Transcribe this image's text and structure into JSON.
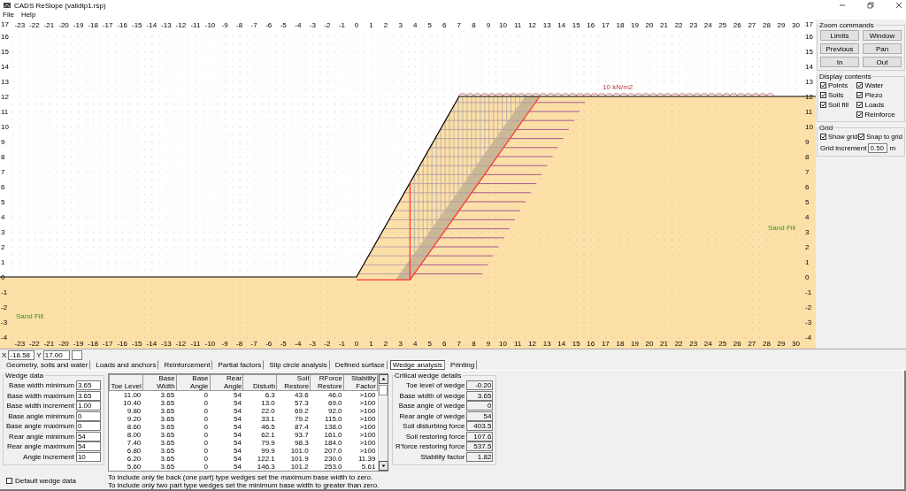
{
  "window": {
    "title": "CADS ReSlope (validtp1.rsp)"
  },
  "menu": [
    "File",
    "Help"
  ],
  "canvas": {
    "top_ruler": [
      "-23",
      "-22",
      "-21",
      "-20",
      "-19",
      "-18",
      "-17",
      "-16",
      "-15",
      "-14",
      "-13",
      "-12",
      "-11",
      "-10",
      "-9",
      "-8",
      "-7",
      "-6",
      "-5",
      "-4",
      "-3",
      "-2",
      "-1",
      "0",
      "1",
      "2",
      "3",
      "4",
      "5",
      "6",
      "7",
      "8",
      "9",
      "10",
      "11",
      "12",
      "13",
      "14",
      "15",
      "16",
      "17",
      "18",
      "19",
      "20",
      "21",
      "22",
      "23",
      "24",
      "25",
      "26",
      "27",
      "28",
      "29",
      "30"
    ],
    "bottom_ruler": [
      "-23",
      "-22",
      "-21",
      "-20",
      "-19",
      "-18",
      "-17",
      "-16",
      "-15",
      "-14",
      "-13",
      "-12",
      "-11",
      "-10",
      "-9",
      "-8",
      "-7",
      "-6",
      "-5",
      "-4",
      "-3",
      "-2",
      "-1",
      "0",
      "1",
      "2",
      "3",
      "4",
      "5",
      "6",
      "7",
      "8",
      "9",
      "10",
      "11",
      "12",
      "13",
      "14",
      "15",
      "16",
      "17",
      "18",
      "19",
      "20",
      "21",
      "22",
      "23",
      "24",
      "25",
      "26",
      "27",
      "28",
      "29",
      "30"
    ],
    "left_ruler": [
      "17",
      "16",
      "15",
      "14",
      "13",
      "12",
      "11",
      "10",
      "9",
      "8",
      "7",
      "6",
      "5",
      "4",
      "3",
      "2",
      "1",
      "0",
      "-1",
      "-2",
      "-3",
      "-4"
    ],
    "right_ruler": [
      "17",
      "16",
      "15",
      "14",
      "13",
      "12",
      "11",
      "10",
      "9",
      "8",
      "7",
      "6",
      "5",
      "4",
      "3",
      "2",
      "1",
      "0",
      "-1",
      "-2",
      "-3",
      "-4"
    ],
    "load_label": "10 kN/m2",
    "soil_labels": [
      "Sand Fill",
      "Sand Fill"
    ]
  },
  "coordinates": {
    "x_label": "X",
    "x_value": "-18.58",
    "y_label": "Y",
    "y_value": "17.00"
  },
  "tabs": [
    {
      "label": "Geometry, soils and water",
      "selected": false
    },
    {
      "label": "Loads and anchors",
      "selected": false
    },
    {
      "label": "Reinforcement",
      "selected": false
    },
    {
      "label": "Partial factors",
      "selected": false
    },
    {
      "label": "Slip circle analysis",
      "selected": false
    },
    {
      "label": "Defined surface",
      "selected": false
    },
    {
      "label": "Wedge analysis",
      "selected": true
    },
    {
      "label": "Printing",
      "selected": false
    }
  ],
  "wedge_data": {
    "title": "Wedge data",
    "fields": [
      {
        "label": "Base width minimum",
        "value": "3.65"
      },
      {
        "label": "Base width maximum",
        "value": "3.65"
      },
      {
        "label": "Base width increment",
        "value": "1.00"
      },
      {
        "label": "Base angle minimum",
        "value": "0"
      },
      {
        "label": "Base angle maximum",
        "value": "0"
      },
      {
        "label": "Rear angle minimum",
        "value": "54"
      },
      {
        "label": "Rear angle maximum",
        "value": "54"
      },
      {
        "label": "Angle increment",
        "value": "10"
      }
    ]
  },
  "table": {
    "columns": [
      "Toe Level",
      "Base Width",
      "Base Angle",
      "Rear Angle",
      "Disturb",
      "Soil Restore",
      "RForce Restore",
      "Stability Factor"
    ],
    "rows": [
      [
        "11.00",
        "3.65",
        "0",
        "54",
        "6.3",
        "43.6",
        "46.0",
        ">100"
      ],
      [
        "10.40",
        "3.65",
        "0",
        "54",
        "13.0",
        "57.3",
        "69.0",
        ">100"
      ],
      [
        "9.80",
        "3.65",
        "0",
        "54",
        "22.0",
        "69.2",
        "92.0",
        ">100"
      ],
      [
        "9.20",
        "3.65",
        "0",
        "54",
        "33.1",
        "79.2",
        "115.0",
        ">100"
      ],
      [
        "8.60",
        "3.65",
        "0",
        "54",
        "46.5",
        "87.4",
        "138.0",
        ">100"
      ],
      [
        "8.00",
        "3.65",
        "0",
        "54",
        "62.1",
        "93.7",
        "161.0",
        ">100"
      ],
      [
        "7.40",
        "3.65",
        "0",
        "54",
        "79.9",
        "98.3",
        "184.0",
        ">100"
      ],
      [
        "6.80",
        "3.65",
        "0",
        "54",
        "99.9",
        "101.0",
        "207.0",
        ">100"
      ],
      [
        "6.20",
        "3.65",
        "0",
        "54",
        "122.1",
        "101.9",
        "230.0",
        "11.39"
      ],
      [
        "5.60",
        "3.65",
        "0",
        "54",
        "146.3",
        "101.2",
        "253.0",
        "5.61"
      ]
    ]
  },
  "critical": {
    "title": "Critical wedge details",
    "fields": [
      {
        "label": "Toe level of wedge",
        "value": "-0.20"
      },
      {
        "label": "Base width of wedge",
        "value": "3.65"
      },
      {
        "label": "Base angle of wedge",
        "value": "0"
      },
      {
        "label": "Rear angle of wedge",
        "value": "54"
      },
      {
        "label": "Soil disturbing force",
        "value": "403.5"
      },
      {
        "label": "Soil restoring force",
        "value": "107.6"
      },
      {
        "label": "R'force restoring force",
        "value": "537.5"
      },
      {
        "label": "Stability factor",
        "value": "1.82"
      }
    ]
  },
  "default_wedge": {
    "label": "Default wedge data",
    "checked": false
  },
  "notes": [
    "To include only tie back (one part) type wedges set the maximum base width to zero.",
    "To include only two part type wedges set the minimum base width to greater than zero."
  ],
  "zoom_commands": {
    "title": "Zoom commands",
    "buttons": [
      "Limits",
      "Window",
      "Previous",
      "Pan",
      "In",
      "Out"
    ]
  },
  "display_contents": {
    "title": "Display contents",
    "items": [
      {
        "label": "Points",
        "checked": true
      },
      {
        "label": "Water",
        "checked": true
      },
      {
        "label": "Soils",
        "checked": true
      },
      {
        "label": "Piezo",
        "checked": true
      },
      {
        "label": "Soil fill",
        "checked": true
      },
      {
        "label": "Loads",
        "checked": true
      },
      {
        "label": "Reinforce",
        "checked": true
      }
    ]
  },
  "grid": {
    "title": "Grid",
    "show_grid": {
      "label": "Show grid",
      "checked": true
    },
    "snap_to_grid": {
      "label": "Snap to grid",
      "checked": true
    },
    "increment": {
      "label": "Grid increment",
      "value": "0.50",
      "unit": "m"
    }
  }
}
